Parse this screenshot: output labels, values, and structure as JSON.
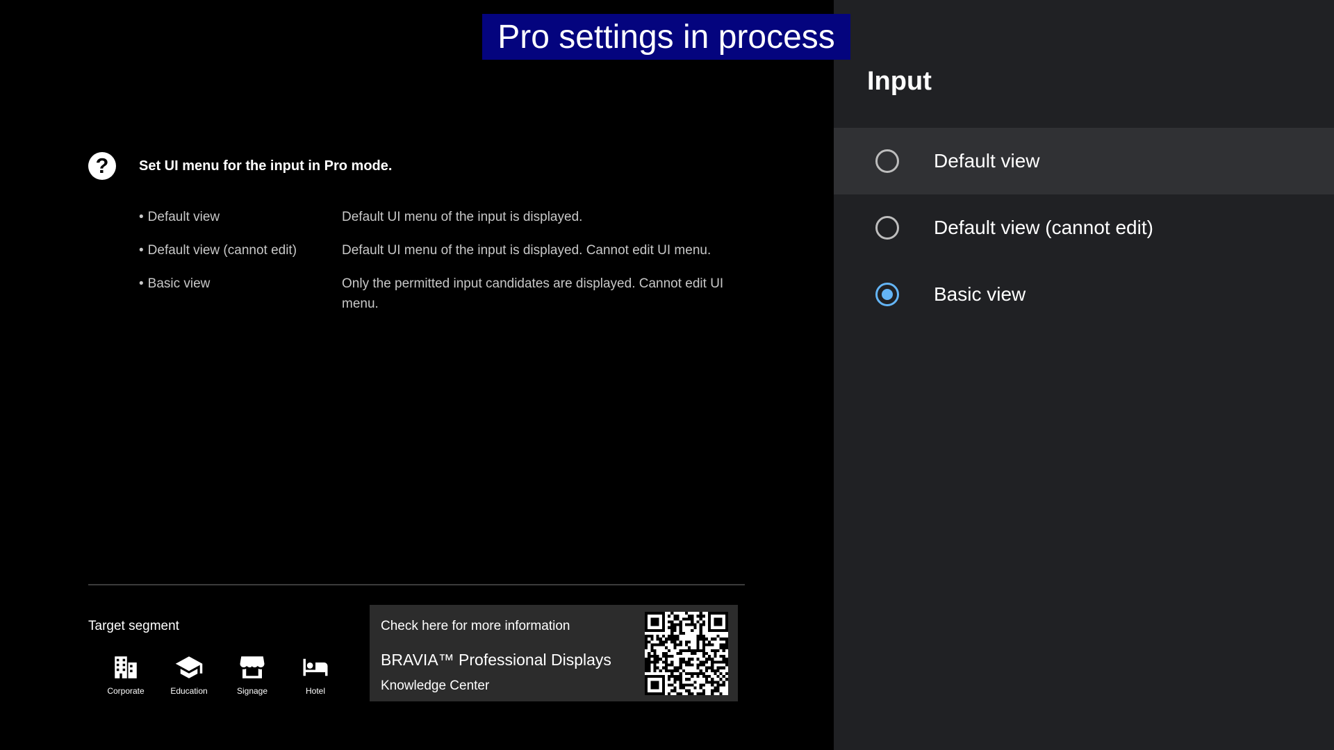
{
  "banner": {
    "text": "Pro settings in process",
    "bg_color": "#04047e"
  },
  "help": {
    "icon": "question-mark-icon",
    "title": "Set UI menu for the input in Pro mode.",
    "definitions": [
      {
        "term": "Default view",
        "desc": "Default UI menu of the input is displayed."
      },
      {
        "term": "Default view (cannot edit)",
        "desc": "Default UI menu of the input is displayed. Cannot edit UI menu."
      },
      {
        "term": "Basic view",
        "desc": "Only the permitted input candidates are displayed. Cannot edit UI menu."
      }
    ]
  },
  "target_segment": {
    "label": "Target segment",
    "items": [
      {
        "icon": "building-icon",
        "label": "Corporate"
      },
      {
        "icon": "graduation-cap-icon",
        "label": "Education"
      },
      {
        "icon": "storefront-icon",
        "label": "Signage"
      },
      {
        "icon": "bed-icon",
        "label": "Hotel"
      }
    ]
  },
  "info_box": {
    "check_text": "Check here for more information",
    "product": "BRAVIA™ Professional Displays",
    "sub": "Knowledge Center",
    "qr": "qr-code-icon"
  },
  "panel": {
    "title": "Input",
    "options": [
      {
        "label": "Default view",
        "checked": false,
        "focused": true
      },
      {
        "label": "Default view (cannot edit)",
        "checked": false,
        "focused": false
      },
      {
        "label": "Basic view",
        "checked": true,
        "focused": false
      }
    ],
    "accent_color": "#64b5f6",
    "bg_color": "#202124"
  }
}
